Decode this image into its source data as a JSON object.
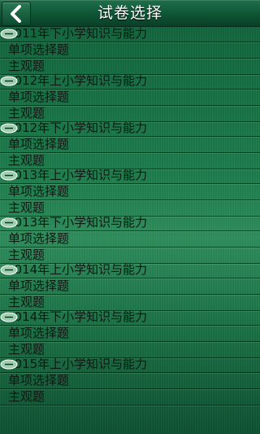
{
  "header": {
    "title": "试卷选择",
    "back_icon": "chevron-left-icon"
  },
  "exams": [
    {
      "year": "2011年下小学知识与能力",
      "options": [
        "单项选择题",
        "主观题"
      ]
    },
    {
      "year": "2012年上小学知识与能力",
      "options": [
        "单项选择题",
        "主观题"
      ]
    },
    {
      "year": "2012年下小学知识与能力",
      "options": [
        "单项选择题",
        "主观题"
      ]
    },
    {
      "year": "2013年上小学知识与能力",
      "options": [
        "单项选择题",
        "主观题"
      ]
    },
    {
      "year": "2013年下小学知识与能力",
      "options": [
        "单项选择题",
        "主观题"
      ]
    },
    {
      "year": "2014年上小学知识与能力",
      "options": [
        "单项选择题",
        "主观题"
      ]
    },
    {
      "year": "2014年下小学知识与能力",
      "options": [
        "单项选择题",
        "主观题"
      ]
    },
    {
      "year": "2015年上小学知识与能力",
      "options": [
        "单项选择题",
        "主观题"
      ]
    }
  ],
  "colors": {
    "accent": "#0e5535",
    "text": "#0b1a12",
    "title_text": "#ffffff"
  }
}
